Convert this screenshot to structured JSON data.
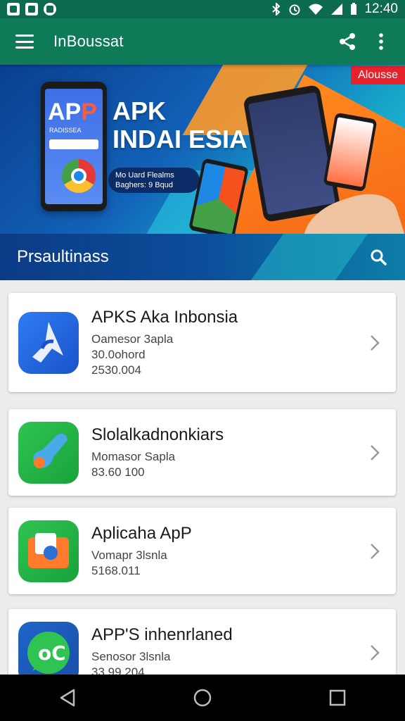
{
  "status_bar": {
    "time": "12:40",
    "icons": [
      "photo-icon",
      "image-icon",
      "sync-icon",
      "bluetooth-icon",
      "alarm-icon",
      "wifi-icon",
      "signal-icon",
      "battery-icon"
    ]
  },
  "app_bar": {
    "title": "InBoussat",
    "actions": [
      "share-icon",
      "more-vert-icon"
    ]
  },
  "banner": {
    "badge": "Alousse",
    "headline_line1": "APK",
    "headline_line2": "INDAI ESIA",
    "phone_title_a": "AP",
    "phone_title_p": "P",
    "phone_subtitle": "RADISSEA",
    "pill_line1": "Mo Uard Flealms",
    "pill_line2": "Baghers: 9 Bqud"
  },
  "section": {
    "title": "Prsaultinass"
  },
  "apps": [
    {
      "name": "APKS Aka Inbonsia",
      "lines": [
        "Oamesor 3apla",
        "30.0ohord",
        "2530.004"
      ],
      "icon": "arrow-app-icon"
    },
    {
      "name": "Slolalkadnonkiars",
      "lines": [
        "Momasor Sapla",
        "83.60 100"
      ],
      "icon": "whistle-app-icon"
    },
    {
      "name": "Aplicaha ApP",
      "lines": [
        "Vomapr 3lsnla",
        "5168.011"
      ],
      "icon": "camera-app-icon"
    },
    {
      "name": "APP'S inhenrlaned",
      "lines": [
        "Senosor 3lsnla",
        "33.99.204"
      ],
      "icon": "chat-app-icon"
    }
  ],
  "nav": [
    "back-icon",
    "home-icon",
    "recents-icon"
  ],
  "colors": {
    "status_bar": "#0c6a4e",
    "app_bar": "#0f7a58",
    "section_bar": "#0b3b86",
    "badge": "#e8222a"
  }
}
